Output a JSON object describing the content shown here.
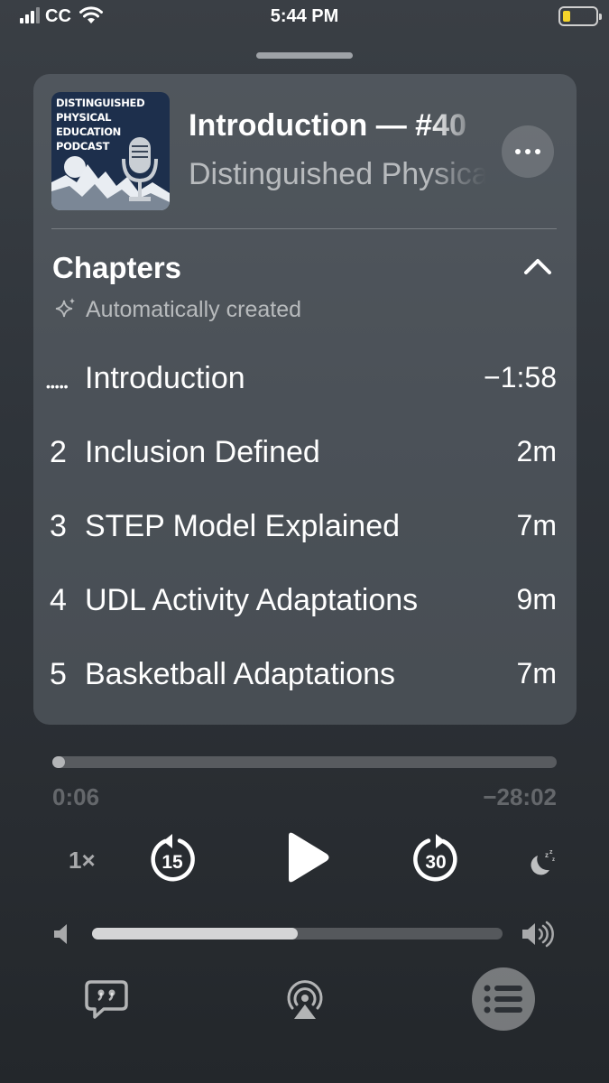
{
  "status_bar": {
    "carrier": "CC",
    "time": "5:44 PM"
  },
  "now_playing": {
    "artwork_text": [
      "DISTINGUISHED",
      "PHYSICAL",
      "EDUCATION",
      "PODCAST"
    ],
    "episode_title": "Introduction — #40",
    "show_name": "Distinguished Physical Education Podcast"
  },
  "chapters": {
    "title": "Chapters",
    "subtitle": "Automatically created",
    "items": [
      {
        "number": "",
        "label": "Introduction",
        "time": "−1:58",
        "current": true
      },
      {
        "number": "2",
        "label": "Inclusion Defined",
        "time": "2m"
      },
      {
        "number": "3",
        "label": "STEP Model Explained",
        "time": "7m"
      },
      {
        "number": "4",
        "label": "UDL Activity Adaptations",
        "time": "9m"
      },
      {
        "number": "5",
        "label": "Basketball Adaptations",
        "time": "7m"
      }
    ]
  },
  "playback": {
    "elapsed": "0:06",
    "remaining": "−28:02",
    "progress_fraction": 0.004,
    "speed": "1×",
    "skip_back_seconds": "15",
    "skip_forward_seconds": "30",
    "volume_fraction": 0.5
  },
  "icons": {
    "signal": "signal-icon",
    "wifi": "wifi-icon",
    "battery": "battery-icon",
    "more": "ellipsis-icon",
    "collapse": "chevron-up-icon",
    "auto": "sparkles-icon",
    "play": "play-icon",
    "sleep": "sleep-timer-icon",
    "lyrics": "transcript-icon",
    "airplay": "airplay-icon",
    "queue": "list-icon"
  },
  "colors": {
    "battery_level": "#f4d42a"
  }
}
